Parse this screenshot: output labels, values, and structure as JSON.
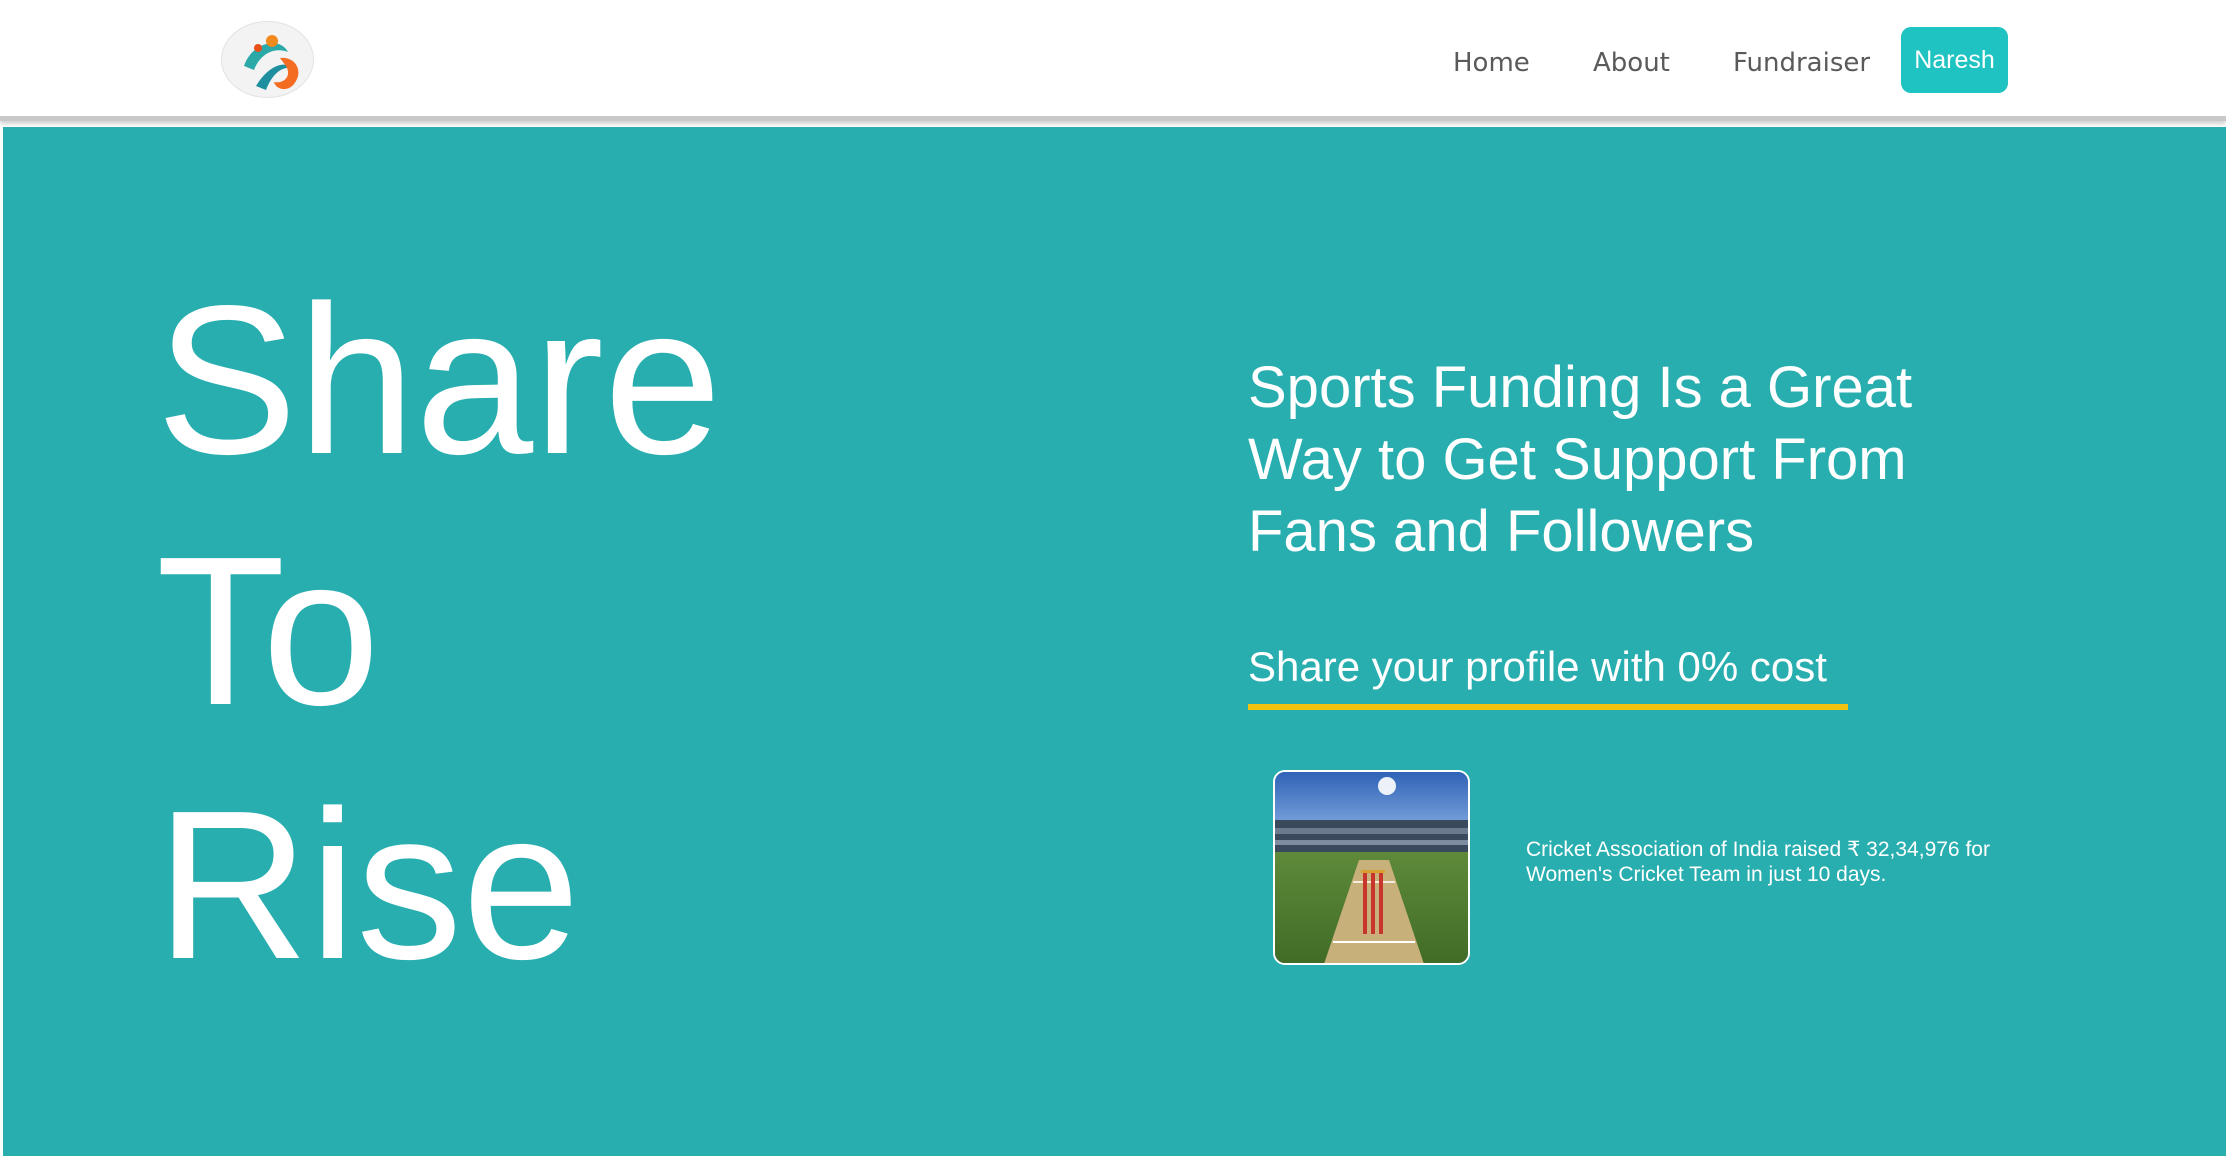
{
  "nav": {
    "logo": "sports-figure-logo",
    "links": [
      {
        "label": "Home"
      },
      {
        "label": "About"
      },
      {
        "label": "Fundraiser"
      }
    ],
    "user_button": "Naresh",
    "accent_color": "#1fc3c2"
  },
  "hero": {
    "background_color": "#29aeb0",
    "words": [
      "Share",
      "To",
      "Rise"
    ],
    "headline": "Sports Funding Is a Great Way to Get Support From Fans and Followers",
    "subheadline": "Share your profile with 0% cost",
    "underline_color": "#f2c20f",
    "story": {
      "image": "cricket-stadium-photo",
      "text": "Cricket Association of India raised ₹ 32,34,976 for Women's Cricket Team in just 10 days."
    }
  }
}
